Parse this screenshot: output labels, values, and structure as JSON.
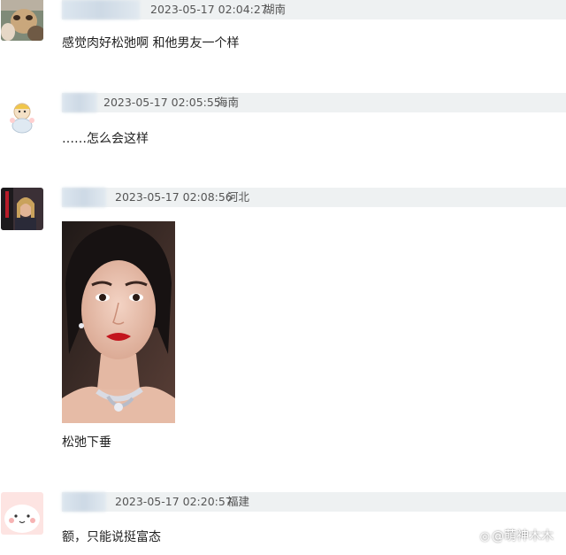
{
  "comments": [
    {
      "timestamp": "2023-05-17 02:04:27",
      "location": "湖南",
      "text": "感觉肉好松弛啊 和他男友一个样"
    },
    {
      "timestamp": "2023-05-17 02:05:55",
      "location": "海南",
      "text": "……怎么会这样"
    },
    {
      "timestamp": "2023-05-17 02:08:56",
      "location": "河北",
      "text": "松弛下垂"
    },
    {
      "timestamp": "2023-05-17 02:20:57",
      "location": "福建",
      "text": "额，只能说挺富态"
    }
  ],
  "watermark": {
    "icon": "weibo-at-icon",
    "text": "@萌神木木"
  },
  "colors": {
    "meta_bar": "#eef1f2",
    "name_blur": "#cdd9e5",
    "body_text": "#222222"
  }
}
